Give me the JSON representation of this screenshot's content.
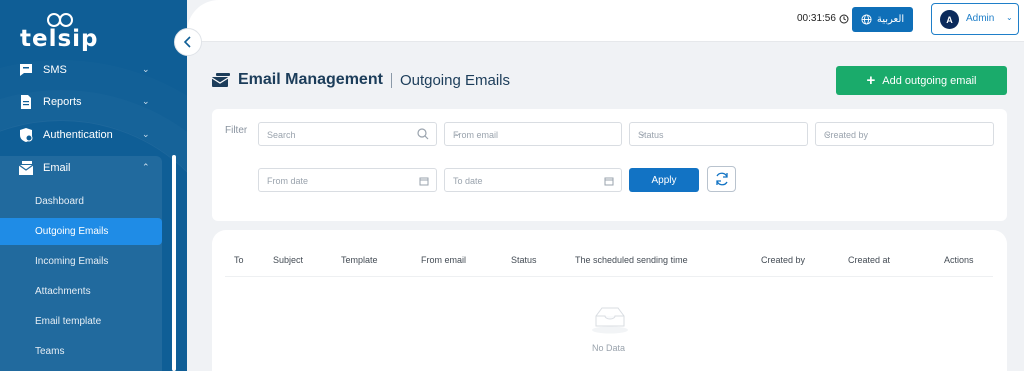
{
  "brand": {
    "logo_text": "telsip"
  },
  "sidebar": {
    "items": [
      {
        "label": "SMS",
        "icon": "chat-icon"
      },
      {
        "label": "Reports",
        "icon": "document-icon"
      },
      {
        "label": "Authentication",
        "icon": "shield-icon"
      },
      {
        "label": "Email",
        "icon": "envelope-icon",
        "expanded": true
      }
    ],
    "email_submenu": [
      {
        "label": "Dashboard"
      },
      {
        "label": "Outgoing Emails",
        "active": true
      },
      {
        "label": "Incoming Emails"
      },
      {
        "label": "Attachments"
      },
      {
        "label": "Email template"
      },
      {
        "label": "Teams"
      }
    ]
  },
  "header": {
    "time": "00:31:56",
    "language_label": "العربية",
    "user": {
      "initial": "A",
      "name": "Admin"
    }
  },
  "page": {
    "title": "Email Management",
    "subtitle": "Outgoing Emails",
    "add_button": "Add outgoing email"
  },
  "filter": {
    "label": "Filter",
    "search_placeholder": "Search",
    "from_email_placeholder": "From email",
    "status_placeholder": "Status",
    "created_by_placeholder": "Created by",
    "from_date_placeholder": "From date",
    "to_date_placeholder": "To date",
    "apply_label": "Apply"
  },
  "table": {
    "columns": [
      "To",
      "Subject",
      "Template",
      "From email",
      "Status",
      "The scheduled sending time",
      "Created by",
      "Created at",
      "Actions"
    ],
    "empty_text": "No Data"
  },
  "colors": {
    "sidebar_bg": "#0f5e96",
    "active_item": "#1f8ce6",
    "primary": "#1273c4",
    "success": "#1aab6b"
  }
}
